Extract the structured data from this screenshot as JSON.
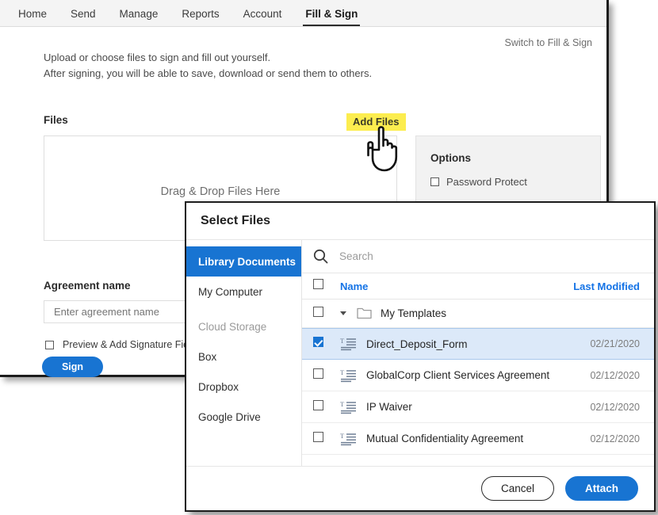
{
  "colors": {
    "accent_blue": "#1874d2",
    "link_blue": "#1473e6",
    "highlight_yellow": "#fced4f",
    "selected_row": "#dce9f9",
    "panel_grey": "#f2f2f2"
  },
  "nav": {
    "items": [
      {
        "label": "Home",
        "active": false
      },
      {
        "label": "Send",
        "active": false
      },
      {
        "label": "Manage",
        "active": false
      },
      {
        "label": "Reports",
        "active": false
      },
      {
        "label": "Account",
        "active": false
      },
      {
        "label": "Fill & Sign",
        "active": true
      }
    ]
  },
  "page": {
    "switch_link": "Switch to Fill & Sign",
    "intro_line1": "Upload or choose files to sign and fill out yourself.",
    "intro_line2": "After signing, you will be able to save, download or send them to others.",
    "files_label": "Files",
    "add_files_label": "Add Files",
    "drop_zone_text": "Drag & Drop Files Here",
    "agreement_label": "Agreement name",
    "agreement_value": "",
    "agreement_placeholder": "Enter agreement name",
    "preview_checkbox_label": "Preview & Add Signature Fields",
    "sign_button": "Sign",
    "cursor_icon": "pointing-hand-cursor"
  },
  "options": {
    "title": "Options",
    "items": [
      {
        "label": "Password Protect",
        "checked": false
      }
    ]
  },
  "dialog": {
    "title": "Select Files",
    "sidebar": [
      {
        "label": "Library Documents",
        "selected": true,
        "section": false
      },
      {
        "label": "My Computer",
        "selected": false,
        "section": false
      },
      {
        "label": "Cloud Storage",
        "selected": false,
        "section": true
      },
      {
        "label": "Box",
        "selected": false,
        "section": false
      },
      {
        "label": "Dropbox",
        "selected": false,
        "section": false
      },
      {
        "label": "Google Drive",
        "selected": false,
        "section": false
      }
    ],
    "search": {
      "value": "",
      "placeholder": "Search",
      "icon": "search-icon"
    },
    "columns": {
      "name": "Name",
      "last_modified": "Last Modified"
    },
    "folder": {
      "label": "My Templates",
      "expanded": true,
      "checked": false,
      "icon": "folder-icon"
    },
    "rows": [
      {
        "name": "Direct_Deposit_Form",
        "modified": "02/21/2020",
        "checked": true,
        "icon": "document-template-icon"
      },
      {
        "name": "GlobalCorp Client Services Agreement",
        "modified": "02/12/2020",
        "checked": false,
        "icon": "document-template-icon"
      },
      {
        "name": "IP Waiver",
        "modified": "02/12/2020",
        "checked": false,
        "icon": "document-template-icon"
      },
      {
        "name": "Mutual Confidentiality Agreement",
        "modified": "02/12/2020",
        "checked": false,
        "icon": "document-template-icon"
      }
    ],
    "footer": {
      "cancel": "Cancel",
      "attach": "Attach"
    }
  }
}
